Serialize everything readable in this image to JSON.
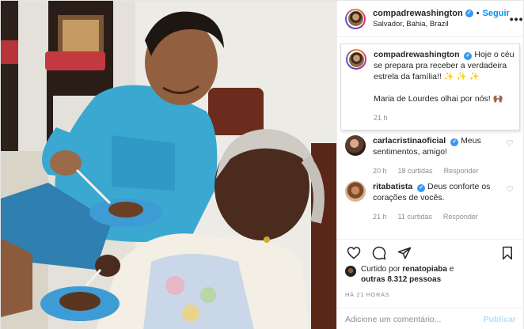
{
  "post": {
    "author": "compadrewashington",
    "follow_label": "Seguir",
    "separator": "•",
    "location": "Salvador, Bahia, Brazil",
    "more_label": "•••",
    "verified_glyph": "✓",
    "icons": {
      "verified": "verified-badge-icon",
      "more": "more-options-icon",
      "like": "heart-icon",
      "comment": "comment-icon",
      "share": "share-icon",
      "save": "bookmark-icon"
    }
  },
  "caption": {
    "username": "compadrewashington",
    "line1": "Hoje o céu se prepara pra receber a verdadeira estrela da família!! ✨ ✨ ✨",
    "line2": "Maria de Lourdes olhai por nós! 🙌🏾",
    "time": "21 h"
  },
  "comments": [
    {
      "username": "carlacristinaoficial",
      "text": "Meus sentimentos, amigo!",
      "time": "20 h",
      "likes": "18 curtidas",
      "reply": "Responder"
    },
    {
      "username": "ritabatista",
      "text": "Deus conforte os corações de vocês.",
      "time": "21 h",
      "likes": "11 curtidas",
      "reply": "Responder"
    }
  ],
  "likes": {
    "prefix": "Curtido por",
    "user": "renatopiaba",
    "conj": "e",
    "others": "outras 8.312 pessoas"
  },
  "timestamp": "HÁ 21 HORAS",
  "add_comment": {
    "placeholder": "Adicione um comentário...",
    "publish_label": "Publicar"
  },
  "colors": {
    "accent": "#0095f6",
    "verified": "#3897f0",
    "muted": "#8e8e8e",
    "publish_disabled": "#b2dffc"
  }
}
